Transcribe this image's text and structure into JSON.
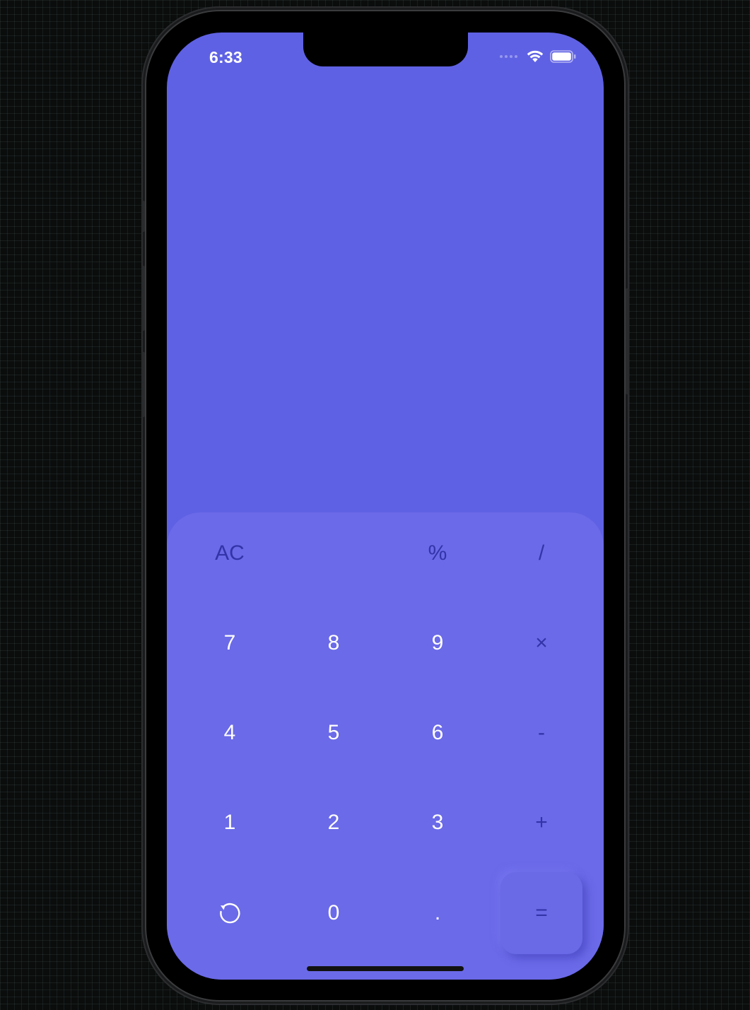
{
  "status_bar": {
    "time": "6:33",
    "wifi_icon": "wifi-icon",
    "battery_icon": "battery-icon"
  },
  "display": {
    "expression": "",
    "result": ""
  },
  "keypad": {
    "row1": [
      "AC",
      "",
      "%",
      "/"
    ],
    "row2": [
      "7",
      "8",
      "9",
      "×"
    ],
    "row3": [
      "4",
      "5",
      "6",
      "-"
    ],
    "row4": [
      "1",
      "2",
      "3",
      "+"
    ],
    "row5": [
      "undo-icon",
      "0",
      ".",
      "="
    ]
  },
  "colors": {
    "background": "#5f61e4",
    "keypad_panel": "#6b6ae8",
    "function_text": "#3234a8",
    "digit_text": "#ffffff"
  }
}
